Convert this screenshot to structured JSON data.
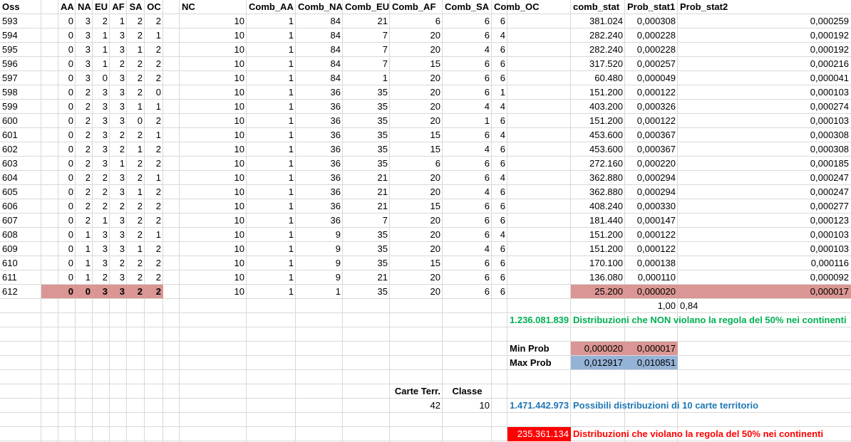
{
  "colors": {
    "grid": "#d9d9d9",
    "highlight_red": "#da9694",
    "highlight_blue": "#95b3d7",
    "bright_red": "#ff0000",
    "green_text": "#00b050",
    "blue_text": "#1f77b4",
    "red_text": "#ff0000"
  },
  "header": [
    "Oss",
    "AA",
    "NA",
    "EU",
    "AF",
    "SA",
    "OC",
    "NC",
    "Comb_AA",
    "Comb_NA",
    "Comb_EU",
    "Comb_AF",
    "Comb_SA",
    "Comb_OC",
    "comb_stat",
    "Prob_stat1",
    "Prob_stat2"
  ],
  "rows": [
    [
      "593",
      "0",
      "3",
      "2",
      "1",
      "2",
      "2",
      "10",
      "1",
      "84",
      "21",
      "6",
      "6",
      "6",
      "381.024",
      "0,000308",
      "0,000259"
    ],
    [
      "594",
      "0",
      "3",
      "1",
      "3",
      "2",
      "1",
      "10",
      "1",
      "84",
      "7",
      "20",
      "6",
      "4",
      "282.240",
      "0,000228",
      "0,000192"
    ],
    [
      "595",
      "0",
      "3",
      "1",
      "3",
      "1",
      "2",
      "10",
      "1",
      "84",
      "7",
      "20",
      "4",
      "6",
      "282.240",
      "0,000228",
      "0,000192"
    ],
    [
      "596",
      "0",
      "3",
      "1",
      "2",
      "2",
      "2",
      "10",
      "1",
      "84",
      "7",
      "15",
      "6",
      "6",
      "317.520",
      "0,000257",
      "0,000216"
    ],
    [
      "597",
      "0",
      "3",
      "0",
      "3",
      "2",
      "2",
      "10",
      "1",
      "84",
      "1",
      "20",
      "6",
      "6",
      "60.480",
      "0,000049",
      "0,000041"
    ],
    [
      "598",
      "0",
      "2",
      "3",
      "3",
      "2",
      "0",
      "10",
      "1",
      "36",
      "35",
      "20",
      "6",
      "1",
      "151.200",
      "0,000122",
      "0,000103"
    ],
    [
      "599",
      "0",
      "2",
      "3",
      "3",
      "1",
      "1",
      "10",
      "1",
      "36",
      "35",
      "20",
      "4",
      "4",
      "403.200",
      "0,000326",
      "0,000274"
    ],
    [
      "600",
      "0",
      "2",
      "3",
      "3",
      "0",
      "2",
      "10",
      "1",
      "36",
      "35",
      "20",
      "1",
      "6",
      "151.200",
      "0,000122",
      "0,000103"
    ],
    [
      "601",
      "0",
      "2",
      "3",
      "2",
      "2",
      "1",
      "10",
      "1",
      "36",
      "35",
      "15",
      "6",
      "4",
      "453.600",
      "0,000367",
      "0,000308"
    ],
    [
      "602",
      "0",
      "2",
      "3",
      "2",
      "1",
      "2",
      "10",
      "1",
      "36",
      "35",
      "15",
      "4",
      "6",
      "453.600",
      "0,000367",
      "0,000308"
    ],
    [
      "603",
      "0",
      "2",
      "3",
      "1",
      "2",
      "2",
      "10",
      "1",
      "36",
      "35",
      "6",
      "6",
      "6",
      "272.160",
      "0,000220",
      "0,000185"
    ],
    [
      "604",
      "0",
      "2",
      "2",
      "3",
      "2",
      "1",
      "10",
      "1",
      "36",
      "21",
      "20",
      "6",
      "4",
      "362.880",
      "0,000294",
      "0,000247"
    ],
    [
      "605",
      "0",
      "2",
      "2",
      "3",
      "1",
      "2",
      "10",
      "1",
      "36",
      "21",
      "20",
      "4",
      "6",
      "362.880",
      "0,000294",
      "0,000247"
    ],
    [
      "606",
      "0",
      "2",
      "2",
      "2",
      "2",
      "2",
      "10",
      "1",
      "36",
      "21",
      "15",
      "6",
      "6",
      "408.240",
      "0,000330",
      "0,000277"
    ],
    [
      "607",
      "0",
      "2",
      "1",
      "3",
      "2",
      "2",
      "10",
      "1",
      "36",
      "7",
      "20",
      "6",
      "6",
      "181.440",
      "0,000147",
      "0,000123"
    ],
    [
      "608",
      "0",
      "1",
      "3",
      "3",
      "2",
      "1",
      "10",
      "1",
      "9",
      "35",
      "20",
      "6",
      "4",
      "151.200",
      "0,000122",
      "0,000103"
    ],
    [
      "609",
      "0",
      "1",
      "3",
      "3",
      "1",
      "2",
      "10",
      "1",
      "9",
      "35",
      "20",
      "4",
      "6",
      "151.200",
      "0,000122",
      "0,000103"
    ],
    [
      "610",
      "0",
      "1",
      "3",
      "2",
      "2",
      "2",
      "10",
      "1",
      "9",
      "35",
      "15",
      "6",
      "6",
      "170.100",
      "0,000138",
      "0,000116"
    ],
    [
      "611",
      "0",
      "1",
      "2",
      "3",
      "2",
      "2",
      "10",
      "1",
      "9",
      "21",
      "20",
      "6",
      "6",
      "136.080",
      "0,000110",
      "0,000092"
    ],
    [
      "612",
      "0",
      "0",
      "3",
      "3",
      "2",
      "2",
      "10",
      "1",
      "1",
      "35",
      "20",
      "6",
      "6",
      "25.200",
      "0,000020",
      "0,000017"
    ]
  ],
  "totals": {
    "prob_stat1": "1,00",
    "prob_stat2": "0,84"
  },
  "non_violating": {
    "value": "1.236.081.839",
    "label": "Distribuzioni che NON violano la regola del 50% nei continenti"
  },
  "min_prob": {
    "label": "Min Prob",
    "v1": "0,000020",
    "v2": "0,000017"
  },
  "max_prob": {
    "label": "Max Prob",
    "v1": "0,012917",
    "v2": "0,010851"
  },
  "carte": {
    "carte_label": "Carte Terr.",
    "classe_label": "Classe",
    "carte_value": "42",
    "classe_value": "10"
  },
  "possible": {
    "value": "1.471.442.973",
    "label": "Possibili distribuzioni di 10 carte territorio"
  },
  "violating": {
    "value": "235.361.134",
    "label": "Distribuzioni che violano la regola del 50% nei continenti"
  }
}
